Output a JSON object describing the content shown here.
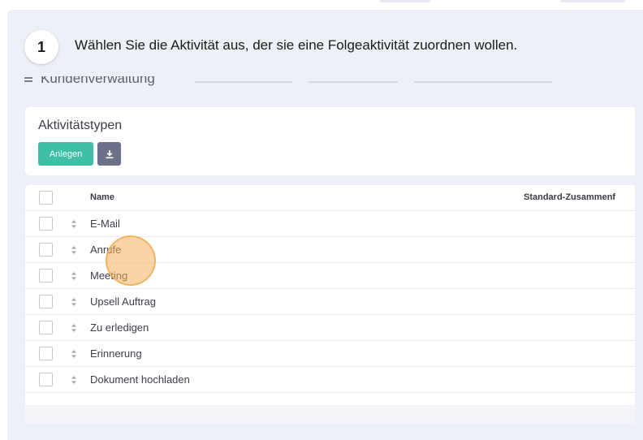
{
  "step": {
    "number": "1",
    "instruction": "Wählen Sie die Aktivität aus, der sie eine Folgeaktivität zuordnen wollen."
  },
  "breadcrumb": {
    "menu_icon": "hamburger-icon",
    "title": "Kundenverwaltung"
  },
  "panel": {
    "title": "Aktivitätstypen",
    "create_label": "Anlegen",
    "download_icon": "download-icon"
  },
  "table": {
    "columns": [
      "Name",
      "Standard-Zusammenf"
    ],
    "rows": [
      {
        "name": "E-Mail"
      },
      {
        "name": "Anrufe"
      },
      {
        "name": "Meeting"
      },
      {
        "name": "Upsell Auftrag"
      },
      {
        "name": "Zu erledigen"
      },
      {
        "name": "Erinnerung"
      },
      {
        "name": "Dokument hochladen"
      }
    ]
  },
  "colors": {
    "accent": "#3ebfa6",
    "secondary_button": "#6c7088",
    "background": "#eef0f7",
    "highlight": "#f4b15c"
  }
}
